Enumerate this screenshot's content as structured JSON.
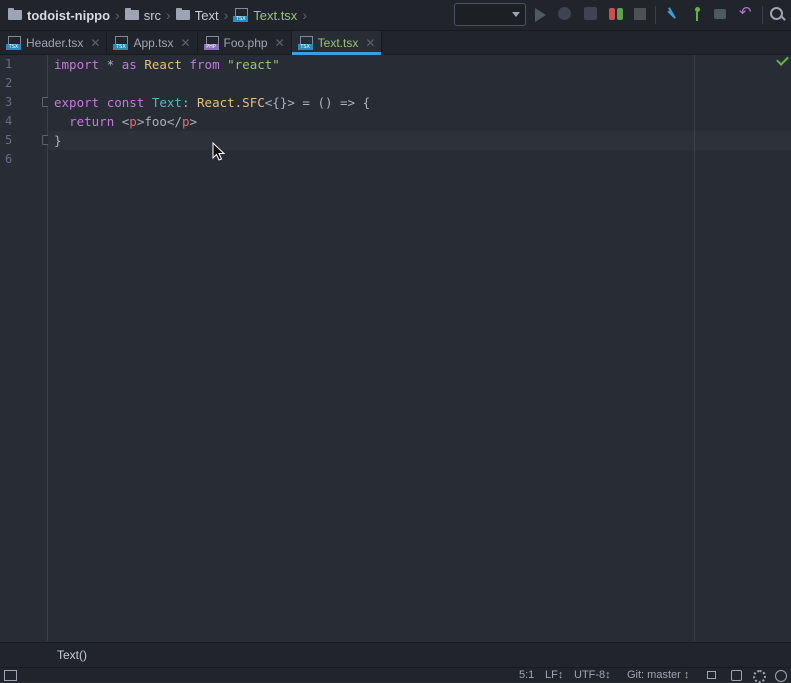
{
  "breadcrumb": {
    "project": "todoist-nippo",
    "folders": [
      "src",
      "Text"
    ],
    "file": "Text.tsx"
  },
  "toolbar": {
    "run_config_value": "",
    "icons": [
      "run-icon",
      "debug-icon",
      "coverage-icon",
      "rerun-icon",
      "stop-icon",
      "vcs-update-icon",
      "vcs-commit-icon",
      "history-icon",
      "revert-icon",
      "search-icon"
    ]
  },
  "tabs": [
    {
      "label": "Header.tsx",
      "icon": "tsx",
      "close": "✕"
    },
    {
      "label": "App.tsx",
      "icon": "tsx",
      "close": "✕"
    },
    {
      "label": "Foo.php",
      "icon": "php",
      "close": "✕"
    },
    {
      "label": "Text.tsx",
      "icon": "tsx",
      "close": "✕",
      "active": true
    }
  ],
  "editor": {
    "line_numbers": [
      "1",
      "2",
      "3",
      "4",
      "5",
      "6"
    ],
    "code": {
      "l1": {
        "kw1": "import",
        "star": " * ",
        "kw2": "as",
        "sp1": " ",
        "cls": "React",
        "sp2": " ",
        "kw3": "from",
        "sp3": " ",
        "str": "\"react\""
      },
      "l3": {
        "kw1": "export",
        "sp1": " ",
        "kw2": "const",
        "sp2": " ",
        "name": "Text",
        "colon": ": ",
        "cls": "React.SFC",
        "rest": "<{}> = () => {"
      },
      "l4": {
        "indent": "  ",
        "kw": "return",
        "open1": " <",
        "tag1": "p",
        "mid": ">foo</",
        "tag2": "p",
        "close": ">"
      },
      "l5": {
        "brace": "}"
      }
    }
  },
  "bottom_breadcrumb": "Text()",
  "status": {
    "position": "5:1",
    "line_separator": "LF↕",
    "encoding": "UTF-8↕",
    "git": "Git: master ↕"
  }
}
